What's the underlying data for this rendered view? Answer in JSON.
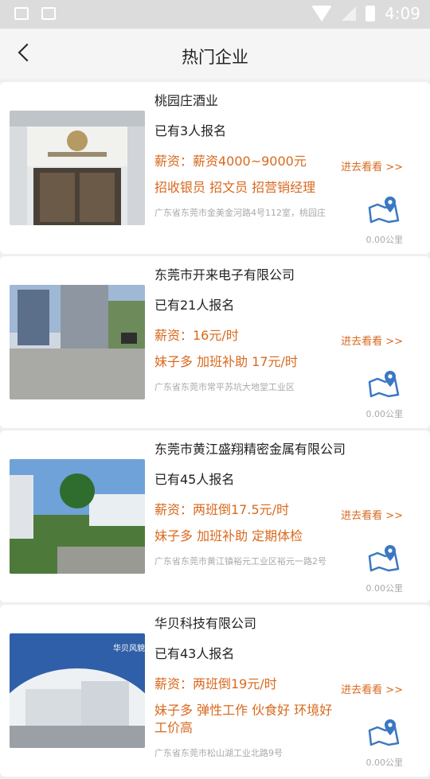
{
  "status_bar": {
    "time": "4:09"
  },
  "header": {
    "title": "热门企业"
  },
  "companies": [
    {
      "name": "桃园庄酒业",
      "signed": "已有3人报名",
      "salary": "薪资：薪资4000~9000元",
      "tags": "招收银员  招文员  招营销经理",
      "address": "广东省东莞市金美金河路4号112室，桃园庄",
      "goto": "进去看看 >>",
      "distance": "0.00公里"
    },
    {
      "name": "东莞市开来电子有限公司",
      "signed": "已有21人报名",
      "salary": "薪资：16元/时",
      "tags": "妹子多  加班补助  17元/时",
      "address": "广东省东莞市常平苏坑大地堂工业区",
      "goto": "进去看看 >>",
      "distance": "0.00公里"
    },
    {
      "name": "东莞市黄江盛翔精密金属有限公司",
      "signed": "已有45人报名",
      "salary": "薪资：两班倒17.5元/时",
      "tags": "妹子多  加班补助  定期体检",
      "address": "广东省东莞市黄江镇裕元工业区裕元一路2号",
      "goto": "进去看看 >>",
      "distance": "0.00公里"
    },
    {
      "name": "华贝科技有限公司",
      "signed": "已有43人报名",
      "salary": "薪资：两班倒19元/时",
      "tags": "妹子多  弹性工作  伙食好  环境好  工价高",
      "address": "广东省东莞市松山湖工业北路9号",
      "goto": "进去看看 >>",
      "distance": "0.00公里",
      "image_caption": "华贝风貌"
    }
  ]
}
